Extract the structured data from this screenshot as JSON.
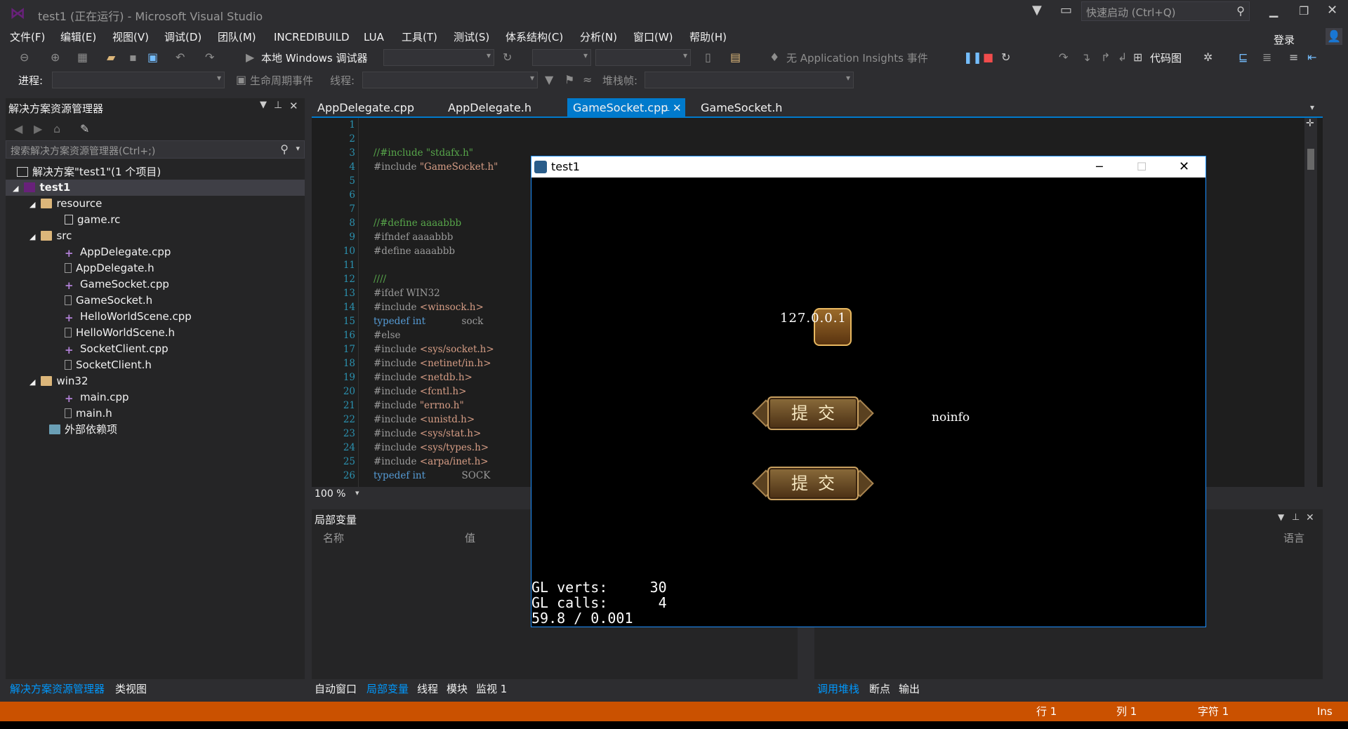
{
  "window": {
    "title": "test1 (正在运行) - Microsoft Visual Studio",
    "quick_launch": "快速启动 (Ctrl+Q)",
    "signin": "登录"
  },
  "menu": [
    "文件(F)",
    "编辑(E)",
    "视图(V)",
    "调试(D)",
    "团队(M)",
    "INCREDIBUILD",
    "LUA",
    "工具(T)",
    "测试(S)",
    "体系结构(C)",
    "分析(N)",
    "窗口(W)",
    "帮助(H)"
  ],
  "toolbar": {
    "debugger": "本地 Windows 调试器",
    "insights": "无 Application Insights 事件",
    "codemap": "代码图",
    "process_label": "进程:",
    "lifecycle": "生命周期事件",
    "thread_label": "线程:",
    "stack_label": "堆栈帧:"
  },
  "solution_explorer": {
    "title": "解决方案资源管理器",
    "search_placeholder": "搜索解决方案资源管理器(Ctrl+;)",
    "solution": "解决方案\"test1\"(1 个项目)",
    "project": "test1",
    "folders": {
      "resource": "resource",
      "src": "src",
      "win32": "win32",
      "external": "外部依赖项"
    },
    "files": {
      "game_rc": "game.rc",
      "appdelegate_cpp": "AppDelegate.cpp",
      "appdelegate_h": "AppDelegate.h",
      "gamesocket_cpp": "GameSocket.cpp",
      "gamesocket_h": "GameSocket.h",
      "helloworld_cpp": "HelloWorldScene.cpp",
      "helloworld_h": "HelloWorldScene.h",
      "socketclient_cpp": "SocketClient.cpp",
      "socketclient_h": "SocketClient.h",
      "main_cpp": "main.cpp",
      "main_h": "main.h"
    }
  },
  "editor_tabs": [
    "AppDelegate.cpp",
    "AppDelegate.h",
    "GameSocket.cpp",
    "GameSocket.h"
  ],
  "code": {
    "l3": "//#include \"stdafx.h\"",
    "l4a": "#include ",
    "l4b": "\"GameSocket.h\"",
    "l8": "//#define aaaabbb",
    "l9": "#ifndef aaaabbb",
    "l10": "#define aaaabbb",
    "l12": "////",
    "l13": "#ifdef WIN32",
    "l14a": "#include ",
    "l14b": "<winsock.h>",
    "l15a": "typedef ",
    "l15b": "int",
    "l15c": "sock",
    "l16": "#else",
    "l17a": "#include ",
    "l17b": "<sys/socket.h>",
    "l18a": "#include ",
    "l18b": "<netinet/in.h>",
    "l19a": "#include ",
    "l19b": "<netdb.h>",
    "l20a": "#include ",
    "l20b": "<fcntl.h>",
    "l21a": "#include ",
    "l21b": "\"errno.h\"",
    "l22a": "#include ",
    "l22b": "<unistd.h>",
    "l23a": "#include ",
    "l23b": "<sys/stat.h>",
    "l24a": "#include ",
    "l24b": "<sys/types.h>",
    "l25a": "#include ",
    "l25b": "<arpa/inet.h>",
    "l26a": "typedef ",
    "l26b": "int",
    "l26c": "SOCK",
    "line_numbers": [
      "1",
      "2",
      "3",
      "4",
      "5",
      "6",
      "7",
      "8",
      "9",
      "10",
      "11",
      "12",
      "13",
      "14",
      "15",
      "16",
      "17",
      "18",
      "19",
      "20",
      "21",
      "22",
      "23",
      "24",
      "25",
      "26"
    ],
    "zoom": "100 %"
  },
  "locals": {
    "title": "局部变量",
    "col_name": "名称",
    "col_value": "值",
    "col_lang": "语言"
  },
  "bottom_tabs_left": [
    "解决方案资源管理器",
    "类视图"
  ],
  "bottom_tabs_mid": [
    "自动窗口",
    "局部变量",
    "线程",
    "模块",
    "监视 1"
  ],
  "bottom_tabs_right": [
    "调用堆栈",
    "断点",
    "输出"
  ],
  "status": {
    "row": "行 1",
    "col": "列 1",
    "char": "字符 1",
    "ins": "Ins"
  },
  "app": {
    "title": "test1",
    "ip": "127.0.0.1",
    "submit1": "提交",
    "submit2": "提交",
    "info": "noinfo",
    "gl_verts": "GL verts:     30",
    "gl_calls": "GL calls:      4",
    "fps": "59.8 / 0.001"
  },
  "colors": {
    "accent": "#007acc",
    "status": "#ca5100",
    "comment": "#57a64a",
    "keyword": "#569cd6",
    "string": "#d69d85"
  }
}
